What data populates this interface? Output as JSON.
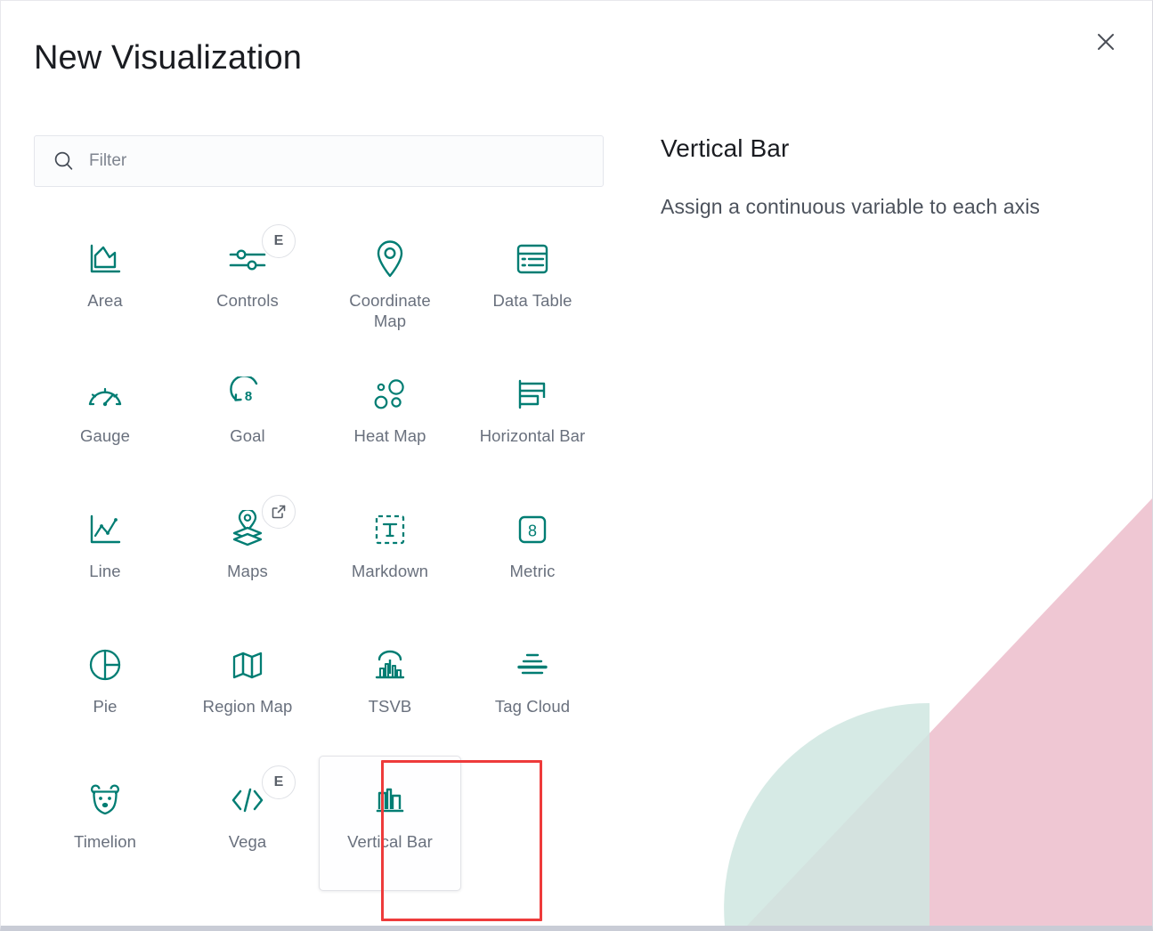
{
  "dialog": {
    "title": "New Visualization",
    "close_label": "×",
    "close_icon": "close-icon"
  },
  "search": {
    "placeholder": "Filter",
    "value": "",
    "icon": "search-icon"
  },
  "visualizations": [
    {
      "label": "Area",
      "icon": "area-chart-icon",
      "badge": "",
      "badge_type": "none",
      "selected": false
    },
    {
      "label": "Controls",
      "icon": "sliders-icon",
      "badge": "E",
      "badge_type": "experimental",
      "selected": false
    },
    {
      "label": "Coordinate Map",
      "icon": "map-pin-icon",
      "badge": "",
      "badge_type": "none",
      "selected": false
    },
    {
      "label": "Data Table",
      "icon": "table-icon",
      "badge": "",
      "badge_type": "none",
      "selected": false
    },
    {
      "label": "Gauge",
      "icon": "gauge-icon",
      "badge": "",
      "badge_type": "none",
      "selected": false
    },
    {
      "label": "Goal",
      "icon": "goal-icon",
      "badge": "",
      "badge_type": "none",
      "selected": false
    },
    {
      "label": "Heat Map",
      "icon": "heatmap-icon",
      "badge": "",
      "badge_type": "none",
      "selected": false
    },
    {
      "label": "Horizontal Bar",
      "icon": "horizontal-bar-icon",
      "badge": "",
      "badge_type": "none",
      "selected": false
    },
    {
      "label": "Line",
      "icon": "line-chart-icon",
      "badge": "",
      "badge_type": "none",
      "selected": false
    },
    {
      "label": "Maps",
      "icon": "maps-layers-icon",
      "badge": "",
      "badge_type": "external-link",
      "selected": false
    },
    {
      "label": "Markdown",
      "icon": "markdown-text-icon",
      "badge": "",
      "badge_type": "none",
      "selected": false
    },
    {
      "label": "Metric",
      "icon": "metric-icon",
      "badge": "",
      "badge_type": "none",
      "selected": false
    },
    {
      "label": "Pie",
      "icon": "pie-chart-icon",
      "badge": "",
      "badge_type": "none",
      "selected": false
    },
    {
      "label": "Region Map",
      "icon": "region-map-icon",
      "badge": "",
      "badge_type": "none",
      "selected": false
    },
    {
      "label": "TSVB",
      "icon": "tsvb-icon",
      "badge": "",
      "badge_type": "none",
      "selected": false
    },
    {
      "label": "Tag Cloud",
      "icon": "tag-cloud-icon",
      "badge": "",
      "badge_type": "none",
      "selected": false
    },
    {
      "label": "Timelion",
      "icon": "timelion-bear-icon",
      "badge": "",
      "badge_type": "none",
      "selected": false
    },
    {
      "label": "Vega",
      "icon": "code-brackets-icon",
      "badge": "E",
      "badge_type": "experimental",
      "selected": false
    },
    {
      "label": "Vertical Bar",
      "icon": "vertical-bar-icon",
      "badge": "",
      "badge_type": "none",
      "selected": true
    }
  ],
  "detail": {
    "title": "Vertical Bar",
    "description": "Assign a continuous variable to each axis"
  },
  "colors": {
    "icon_teal": "#017d73",
    "text_primary": "#1a1c21",
    "text_secondary": "#69707d",
    "highlight_red": "#ee3b3b",
    "art_pink": "#eec4d1",
    "art_teal": "#cce5e1"
  }
}
